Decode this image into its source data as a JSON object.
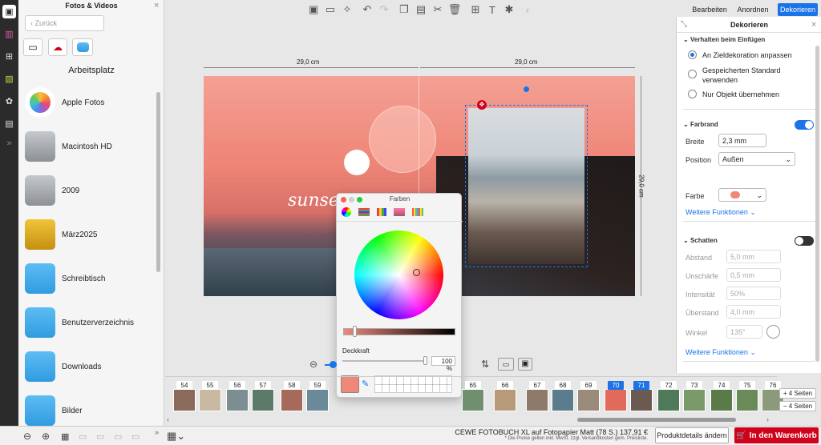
{
  "left_panel": {
    "title": "Fotos & Videos",
    "back_label": "Zurück",
    "section_title": "Arbeitsplatz",
    "sources": [
      {
        "label": "Apple Fotos",
        "icon": "apple-photos-icon"
      },
      {
        "label": "Macintosh HD",
        "icon": "hard-disk-icon"
      },
      {
        "label": "2009",
        "icon": "hard-disk-icon"
      },
      {
        "label": "März2025",
        "icon": "external-drive-icon"
      },
      {
        "label": "Schreibtisch",
        "icon": "desktop-folder-icon"
      },
      {
        "label": "Benutzerverzeichnis",
        "icon": "home-folder-icon"
      },
      {
        "label": "Downloads",
        "icon": "downloads-folder-icon"
      },
      {
        "label": "Bilder",
        "icon": "pictures-folder-icon"
      }
    ]
  },
  "ruler": {
    "left_width": "29,0 cm",
    "right_width": "29,0 cm",
    "height": "29,0 cm"
  },
  "canvas": {
    "text": "sunset"
  },
  "color_panel": {
    "title": "Farben",
    "opacity_label": "Deckkraft",
    "opacity_value": "100 %"
  },
  "right_panel": {
    "tabs": [
      {
        "label": "Bearbeiten",
        "active": false
      },
      {
        "label": "Anordnen",
        "active": false
      },
      {
        "label": "Dekorieren",
        "active": true
      }
    ],
    "title": "Dekorieren",
    "insert_behavior": {
      "heading": "Verhalten beim Einfügen",
      "options": [
        {
          "label": "An Zieldekoration anpassen",
          "selected": true
        },
        {
          "label": "Gespeicherten Standard verwenden",
          "selected": false
        },
        {
          "label": "Nur Objekt übernehmen",
          "selected": false
        }
      ]
    },
    "frame": {
      "heading": "Farbrand",
      "enabled": true,
      "width_label": "Breite",
      "width_value": "2,3 mm",
      "position_label": "Position",
      "position_value": "Außen",
      "color_label": "Farbe",
      "color": "#f0887a",
      "more_label": "Weitere Funktionen"
    },
    "shadow": {
      "heading": "Schatten",
      "enabled": false,
      "distance_label": "Abstand",
      "distance_value": "5,0 mm",
      "blur_label": "Unschärfe",
      "blur_value": "0,5 mm",
      "intensity_label": "Intensität",
      "intensity_value": "50%",
      "overhang_label": "Überstand",
      "overhang_value": "4,0 mm",
      "angle_label": "Winkel",
      "angle_value": "135°",
      "more_label": "Weitere Funktionen"
    }
  },
  "pages": [
    {
      "num": "54",
      "selected": false
    },
    {
      "num": "55",
      "selected": false
    },
    {
      "num": "56",
      "selected": false
    },
    {
      "num": "57",
      "selected": false
    },
    {
      "num": "58",
      "selected": false
    },
    {
      "num": "59",
      "selected": false
    },
    {
      "num": "65",
      "selected": false
    },
    {
      "num": "66",
      "selected": false
    },
    {
      "num": "67",
      "selected": false
    },
    {
      "num": "68",
      "selected": false
    },
    {
      "num": "69",
      "selected": false
    },
    {
      "num": "70",
      "selected": true
    },
    {
      "num": "71",
      "selected": true
    },
    {
      "num": "72",
      "selected": false
    },
    {
      "num": "73",
      "selected": false
    },
    {
      "num": "74",
      "selected": false
    },
    {
      "num": "75",
      "selected": false
    },
    {
      "num": "76",
      "selected": false
    }
  ],
  "page_buttons": {
    "add": "+ 4 Seiten",
    "remove": "− 4 Seiten"
  },
  "bottom": {
    "product": "CEWE FOTOBUCH XL auf Fotopapier Matt (78 S.) 137,91 €",
    "note": "* Die Preise gelten inkl. MwSt. zzgl. Versandkosten gem. Preisliste.",
    "details_button": "Produktdetails ändern",
    "cart_button": "In den Warenkorb"
  },
  "colors": {
    "accent": "#1a73e8",
    "cart": "#d0021b"
  }
}
